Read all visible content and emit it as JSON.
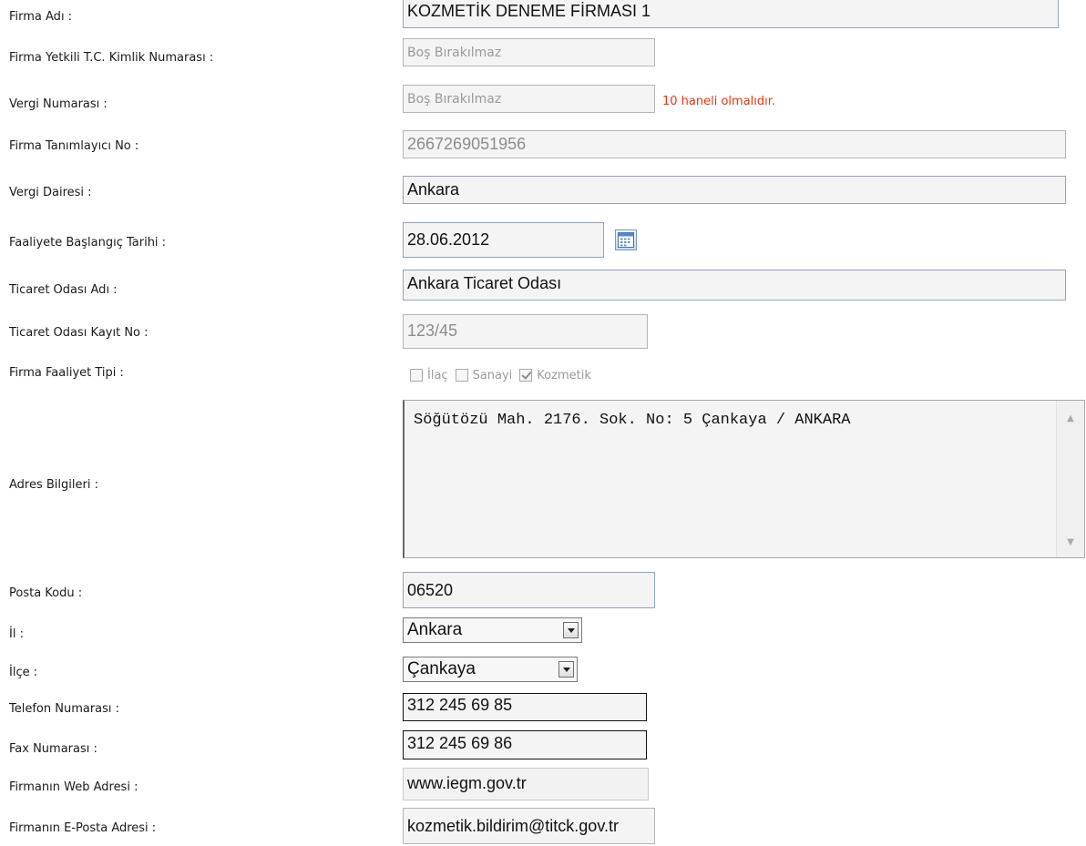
{
  "labels": {
    "firma_adi": "Firma Adı :",
    "tc_kimlik": "Firma Yetkili T.C. Kimlik Numarası :",
    "vergi_no": "Vergi Numarası :",
    "tanimlayici": "Firma Tanımlayıcı No :",
    "vergi_dairesi": "Vergi Dairesi :",
    "baslangic": "Faaliyete Başlangıç Tarihi :",
    "oda_adi": "Ticaret Odası Adı :",
    "oda_kayit": "Ticaret Odası Kayıt No :",
    "faaliyet_tipi": "Firma Faaliyet Tipi :",
    "adres": "Adres Bilgileri :",
    "posta": "Posta Kodu :",
    "il": "İl :",
    "ilce": "İlçe :",
    "telefon": "Telefon Numarası :",
    "fax": "Fax Numarası :",
    "web": "Firmanın Web Adresi :",
    "eposta": "Firmanın E-Posta Adresi :"
  },
  "values": {
    "firma_adi": "KOZMETİK DENEME FİRMASI 1",
    "tc_kimlik_placeholder": "Boş Bırakılmaz",
    "vergi_no_placeholder": "Boş Bırakılmaz",
    "vergi_no_warning": "10 haneli olmalıdır.",
    "tanimlayici": "2667269051956",
    "vergi_dairesi": "Ankara",
    "baslangic": "28.06.2012",
    "oda_adi": "Ankara Ticaret Odası",
    "oda_kayit": "123/45",
    "adres": "Söğütözü Mah. 2176. Sok. No: 5 Çankaya / ANKARA",
    "posta": "06520",
    "il": "Ankara",
    "ilce": "Çankaya",
    "telefon": "312 245 69 85",
    "fax": "312 245 69 86",
    "web": "www.iegm.gov.tr",
    "eposta": "kozmetik.bildirim@titck.gov.tr"
  },
  "faaliyet_options": [
    {
      "label": "İlaç",
      "checked": false
    },
    {
      "label": "Sanayi",
      "checked": false
    },
    {
      "label": "Kozmetik",
      "checked": true
    }
  ],
  "icons": {
    "calendar": "calendar-icon",
    "dropdown": "chevron-down-icon"
  },
  "colors": {
    "warning": "#e8360f",
    "field_border": "#8fa3bd"
  }
}
